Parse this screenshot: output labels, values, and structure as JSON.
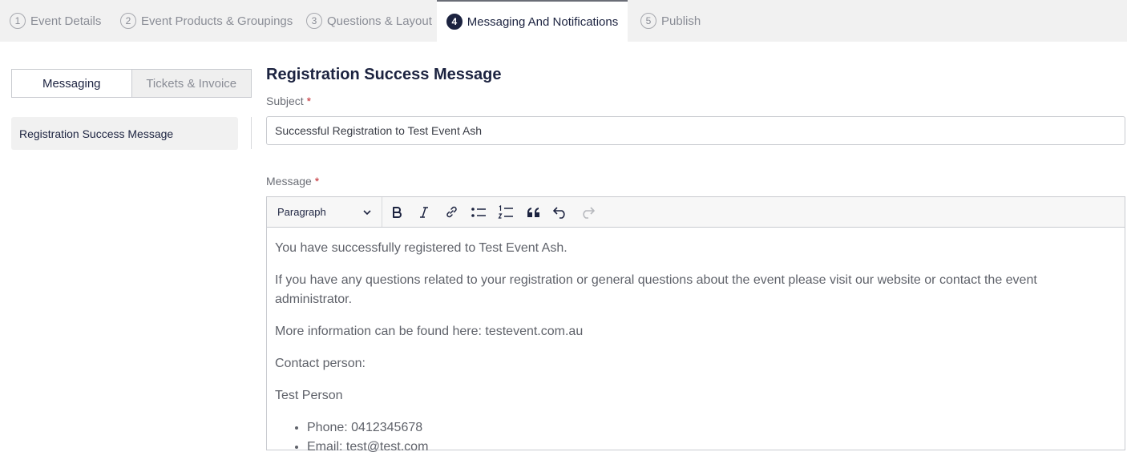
{
  "steps": [
    {
      "num": "1",
      "label": "Event Details"
    },
    {
      "num": "2",
      "label": "Event Products & Groupings"
    },
    {
      "num": "3",
      "label": "Questions & Layout"
    },
    {
      "num": "4",
      "label": "Messaging And Notifications"
    },
    {
      "num": "5",
      "label": "Publish"
    }
  ],
  "sidebar": {
    "tabs": [
      "Messaging",
      "Tickets & Invoice"
    ],
    "items": [
      {
        "label": "Registration Success Message"
      }
    ]
  },
  "main": {
    "title": "Registration Success Message",
    "subject_label": "Subject",
    "subject_value": "Successful Registration to Test Event Ash",
    "message_label": "Message",
    "required_mark": "*"
  },
  "editor": {
    "block_format": "Paragraph",
    "toolbar_icons": [
      "bold-icon",
      "italic-icon",
      "link-icon",
      "bulleted-list-icon",
      "numbered-list-icon",
      "blockquote-icon",
      "undo-icon",
      "redo-icon"
    ],
    "paragraphs": [
      "You have successfully registered to Test Event Ash.",
      "If you have any questions related to your registration or general questions about the event please visit our website or contact the event administrator.",
      "More information can be found here: testevent.com.au",
      "Contact person:",
      "Test Person"
    ],
    "list_items": [
      "Phone: 0412345678",
      "Email: test@test.com"
    ]
  },
  "colors": {
    "brand_navy": "#1c2340",
    "required": "#c0272d",
    "tab_bar_bg": "#f1f1f1"
  }
}
